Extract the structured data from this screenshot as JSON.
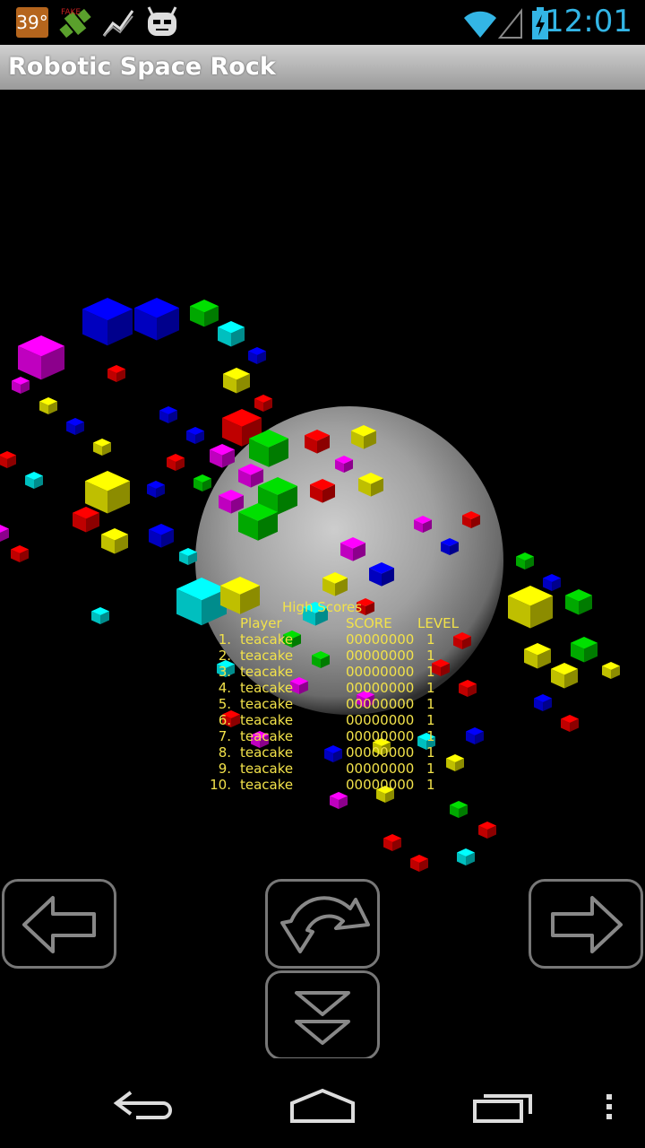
{
  "status_bar": {
    "temperature": "39°",
    "clock": "12:01",
    "colors": {
      "clock": "#33b5e5",
      "temp_badge": "#b5651d"
    },
    "icons": [
      "temperature-badge",
      "fake-gps-icon",
      "activity-graph-icon",
      "cyanogen-mascot-icon",
      "wifi-icon",
      "cell-signal-icon",
      "battery-charging-icon"
    ]
  },
  "app": {
    "title": "Robotic Space Rock"
  },
  "high_scores": {
    "title": "High Scores",
    "headers": {
      "player": "Player",
      "score": "SCORE",
      "level": "LEVEL"
    },
    "rows": [
      {
        "rank": "1.",
        "player": "teacake",
        "score": "00000000",
        "level": "1"
      },
      {
        "rank": "2.",
        "player": "teacake",
        "score": "00000000",
        "level": "1"
      },
      {
        "rank": "3.",
        "player": "teacake",
        "score": "00000000",
        "level": "1"
      },
      {
        "rank": "4.",
        "player": "teacake",
        "score": "00000000",
        "level": "1"
      },
      {
        "rank": "5.",
        "player": "teacake",
        "score": "00000000",
        "level": "1"
      },
      {
        "rank": "6.",
        "player": "teacake",
        "score": "00000000",
        "level": "1"
      },
      {
        "rank": "7.",
        "player": "teacake",
        "score": "00000000",
        "level": "1"
      },
      {
        "rank": "8.",
        "player": "teacake",
        "score": "00000000",
        "level": "1"
      },
      {
        "rank": "9.",
        "player": "teacake",
        "score": "00000000",
        "level": "1"
      },
      {
        "rank": "10.",
        "player": "teacake",
        "score": "00000000",
        "level": "1"
      }
    ],
    "text_color": "#f2e24a"
  },
  "controls": {
    "icons": [
      "rotate-left-arrow-icon",
      "thrust-curved-arrow-icon",
      "rotate-right-arrow-icon",
      "hyperspace-double-chevron-icon"
    ]
  },
  "nav_bar": {
    "icons": [
      "back-icon",
      "home-icon",
      "recent-apps-icon",
      "menu-overflow-icon"
    ]
  },
  "scene": {
    "cube_colors": [
      "#ff0000",
      "#00e000",
      "#0000ff",
      "#ffff00",
      "#00ffff",
      "#ff00ff"
    ]
  }
}
